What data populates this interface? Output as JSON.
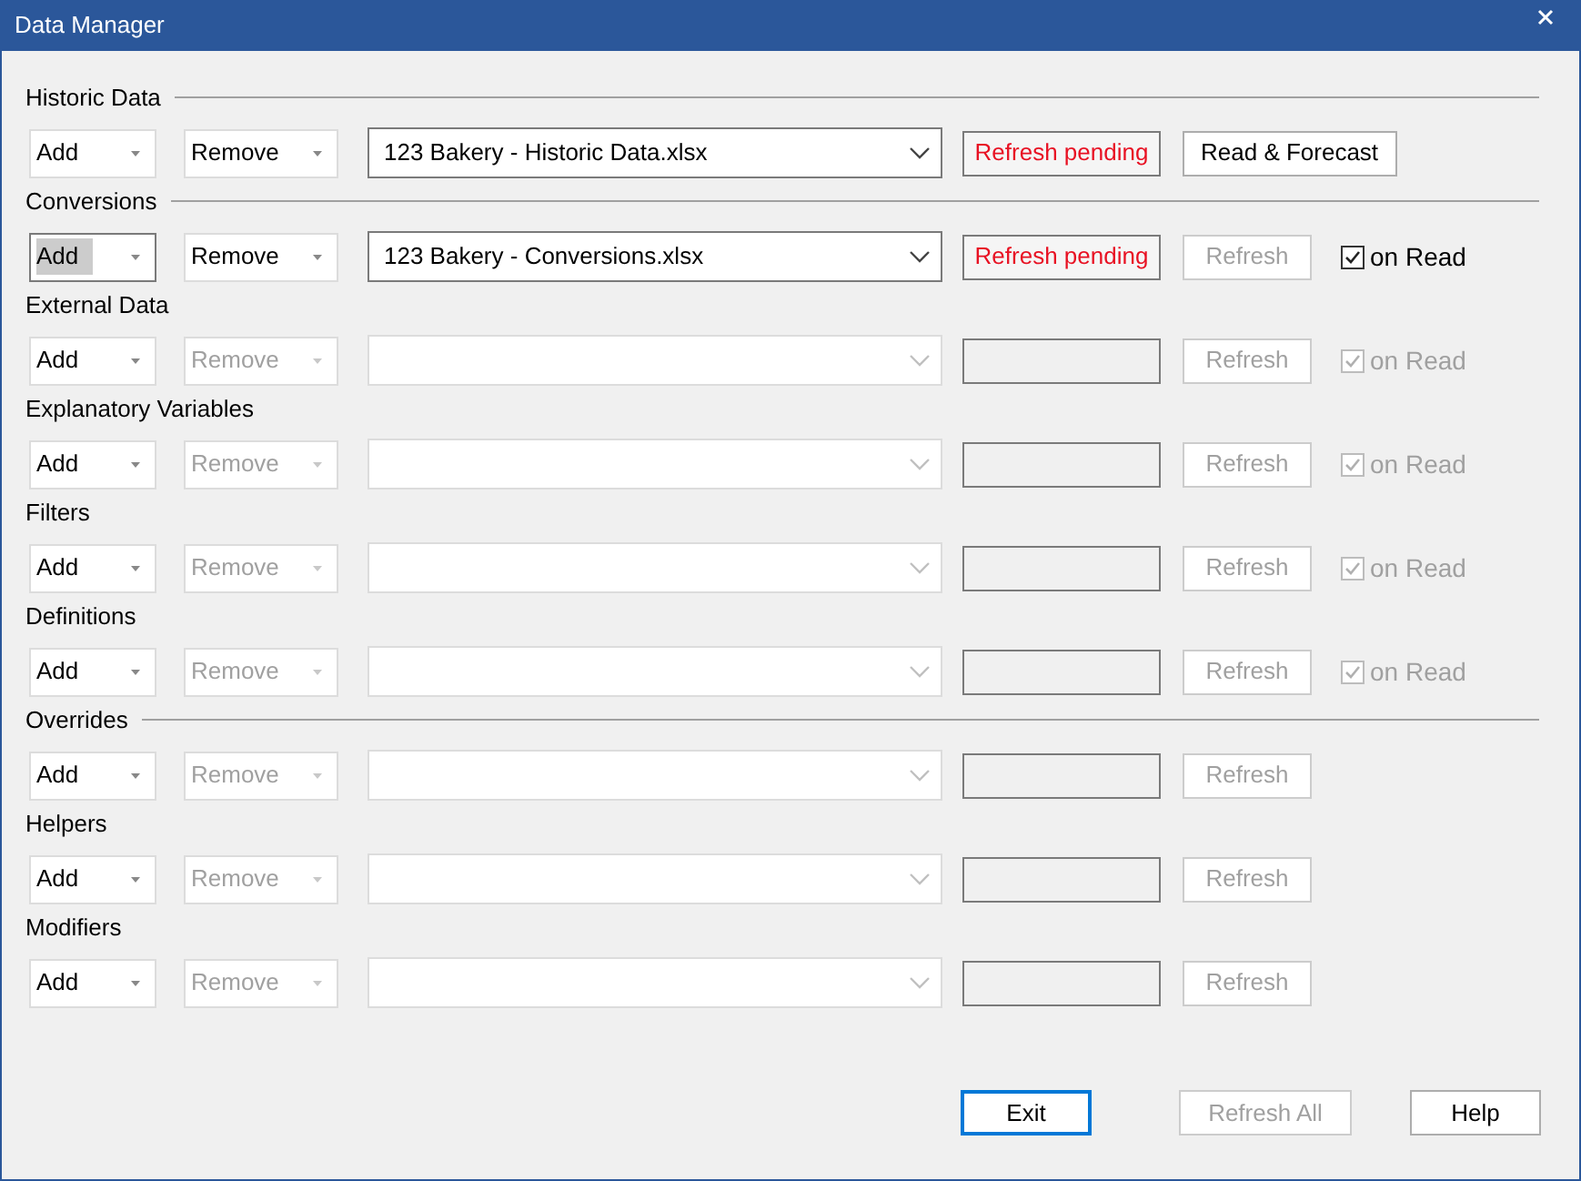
{
  "window": {
    "title": "Data Manager"
  },
  "sections": [
    {
      "title": "Historic Data",
      "divider": true,
      "add": {
        "label": "Add",
        "disabled": false,
        "focused": false
      },
      "remove": {
        "label": "Remove",
        "disabled": false
      },
      "file": {
        "value": "123 Bakery - Historic Data.xlsx",
        "disabled": false
      },
      "status": {
        "kind": "pending",
        "text": "Refresh pending"
      },
      "action": {
        "label": "Read & Forecast",
        "disabled": false
      }
    },
    {
      "title": "Conversions",
      "divider": true,
      "add": {
        "label": "Add",
        "disabled": false,
        "focused": true
      },
      "remove": {
        "label": "Remove",
        "disabled": false
      },
      "file": {
        "value": "123 Bakery - Conversions.xlsx",
        "disabled": false
      },
      "status": {
        "kind": "pending",
        "text": "Refresh pending"
      },
      "action": {
        "label": "Refresh",
        "disabled": true
      },
      "on_read": {
        "label": "on Read",
        "checked": true,
        "disabled": false
      }
    },
    {
      "title": "External Data",
      "divider": false,
      "add": {
        "label": "Add",
        "disabled": false,
        "focused": false
      },
      "remove": {
        "label": "Remove",
        "disabled": true
      },
      "file": {
        "disabled": true
      },
      "status": {
        "kind": "empty"
      },
      "action": {
        "label": "Refresh",
        "disabled": true
      },
      "on_read": {
        "label": "on Read",
        "checked": true,
        "disabled": true
      }
    },
    {
      "title": "Explanatory Variables",
      "divider": false,
      "add": {
        "label": "Add",
        "disabled": false,
        "focused": false
      },
      "remove": {
        "label": "Remove",
        "disabled": true
      },
      "file": {
        "disabled": true
      },
      "status": {
        "kind": "empty"
      },
      "action": {
        "label": "Refresh",
        "disabled": true
      },
      "on_read": {
        "label": "on Read",
        "checked": true,
        "disabled": true
      }
    },
    {
      "title": "Filters",
      "divider": false,
      "add": {
        "label": "Add",
        "disabled": false,
        "focused": false
      },
      "remove": {
        "label": "Remove",
        "disabled": true
      },
      "file": {
        "disabled": true
      },
      "status": {
        "kind": "empty"
      },
      "action": {
        "label": "Refresh",
        "disabled": true
      },
      "on_read": {
        "label": "on Read",
        "checked": true,
        "disabled": true
      }
    },
    {
      "title": "Definitions",
      "divider": false,
      "add": {
        "label": "Add",
        "disabled": false,
        "focused": false
      },
      "remove": {
        "label": "Remove",
        "disabled": true
      },
      "file": {
        "disabled": true
      },
      "status": {
        "kind": "empty"
      },
      "action": {
        "label": "Refresh",
        "disabled": true
      },
      "on_read": {
        "label": "on Read",
        "checked": true,
        "disabled": true
      }
    },
    {
      "title": "Overrides",
      "divider": true,
      "add": {
        "label": "Add",
        "disabled": false,
        "focused": false
      },
      "remove": {
        "label": "Remove",
        "disabled": true
      },
      "file": {
        "disabled": true
      },
      "status": {
        "kind": "empty"
      },
      "action": {
        "label": "Refresh",
        "disabled": true
      }
    },
    {
      "title": "Helpers",
      "divider": false,
      "add": {
        "label": "Add",
        "disabled": false,
        "focused": false
      },
      "remove": {
        "label": "Remove",
        "disabled": true
      },
      "file": {
        "disabled": true
      },
      "status": {
        "kind": "empty"
      },
      "action": {
        "label": "Refresh",
        "disabled": true
      }
    },
    {
      "title": "Modifiers",
      "divider": false,
      "add": {
        "label": "Add",
        "disabled": false,
        "focused": false
      },
      "remove": {
        "label": "Remove",
        "disabled": true
      },
      "file": {
        "disabled": true
      },
      "status": {
        "kind": "empty"
      },
      "action": {
        "label": "Refresh",
        "disabled": true
      }
    }
  ],
  "footer_buttons": [
    {
      "label": "Exit",
      "disabled": false,
      "default": true
    },
    {
      "label": "Refresh All",
      "disabled": true,
      "default": false
    },
    {
      "label": "Help",
      "disabled": false,
      "default": false
    }
  ]
}
